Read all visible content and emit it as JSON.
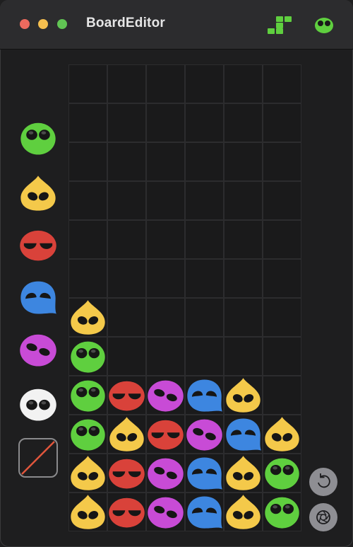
{
  "window": {
    "title": "BoardEditor"
  },
  "toolbar": {
    "grid_icon": "tetromino-grid-icon",
    "puyo_icon": "green-puyo-icon"
  },
  "palette": {
    "items": [
      {
        "name": "green",
        "color": "#5fcf3f"
      },
      {
        "name": "yellow",
        "color": "#f4c94a"
      },
      {
        "name": "red",
        "color": "#d9423a"
      },
      {
        "name": "blue",
        "color": "#3d86e0"
      },
      {
        "name": "purple",
        "color": "#c84bd6"
      },
      {
        "name": "white",
        "color": "#f2f2f2"
      }
    ],
    "eraser": "eraser-icon"
  },
  "board": {
    "columns": 6,
    "rows": 12,
    "cells": [
      [
        "",
        "",
        "",
        "",
        "",
        ""
      ],
      [
        "",
        "",
        "",
        "",
        "",
        ""
      ],
      [
        "",
        "",
        "",
        "",
        "",
        ""
      ],
      [
        "",
        "",
        "",
        "",
        "",
        ""
      ],
      [
        "",
        "",
        "",
        "",
        "",
        ""
      ],
      [
        "",
        "",
        "",
        "",
        "",
        ""
      ],
      [
        "yellow",
        "",
        "",
        "",
        "",
        ""
      ],
      [
        "green",
        "",
        "",
        "",
        "",
        ""
      ],
      [
        "green",
        "red",
        "purple",
        "blue",
        "yellow",
        ""
      ],
      [
        "green",
        "yellow",
        "red",
        "purple",
        "blue",
        "yellow"
      ],
      [
        "yellow",
        "red",
        "purple",
        "blue",
        "yellow",
        "green"
      ],
      [
        "yellow",
        "red",
        "purple",
        "blue",
        "yellow",
        "green"
      ]
    ]
  },
  "actions": {
    "reset_icon": "reset-icon",
    "capture_icon": "camera-aperture-icon"
  }
}
